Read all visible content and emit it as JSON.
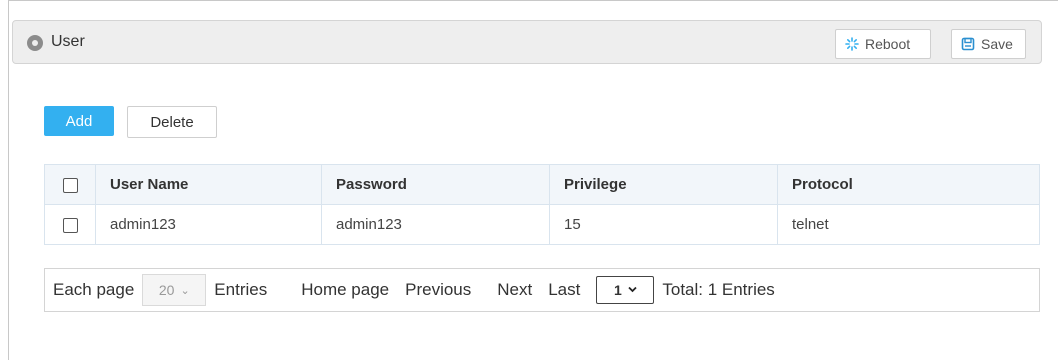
{
  "header": {
    "title": "User",
    "reboot_label": "Reboot",
    "save_label": "Save"
  },
  "actions": {
    "add_label": "Add",
    "delete_label": "Delete"
  },
  "table": {
    "columns": [
      "User Name",
      "Password",
      "Privilege",
      "Protocol"
    ],
    "rows": [
      {
        "user_name": "admin123",
        "password": "admin123",
        "privilege": "15",
        "protocol": "telnet"
      }
    ]
  },
  "pager": {
    "each_page_label": "Each page",
    "page_size": "20",
    "entries_label": "Entries",
    "home_label": "Home page",
    "previous_label": "Previous",
    "next_label": "Next",
    "last_label": "Last",
    "current_page": "1",
    "total_label": "Total: 1 Entries"
  },
  "colors": {
    "accent": "#33b0f0",
    "header_bg": "#eeeeee",
    "table_head_bg": "#f2f6fa"
  },
  "icons": [
    "location-pin-icon",
    "reboot-icon",
    "save-icon",
    "chevron-down-icon"
  ]
}
